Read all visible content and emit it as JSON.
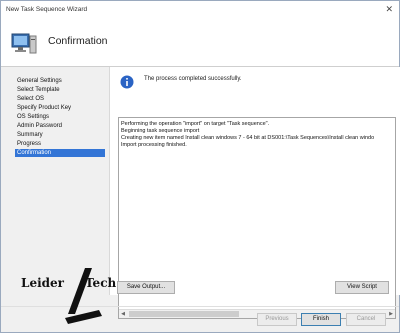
{
  "window": {
    "title": "New Task Sequence Wizard",
    "close_glyph": "✕"
  },
  "header": {
    "title": "Confirmation",
    "icon": "computer-icon"
  },
  "nav": {
    "items": [
      {
        "label": "General Settings"
      },
      {
        "label": "Select Template"
      },
      {
        "label": "Select OS"
      },
      {
        "label": "Specify Product Key"
      },
      {
        "label": "OS Settings"
      },
      {
        "label": "Admin Password"
      },
      {
        "label": "Summary"
      },
      {
        "label": "Progress"
      },
      {
        "label": "Confirmation"
      }
    ],
    "active_index": 8,
    "active_color": "#3375d6"
  },
  "content": {
    "status_message": "The process completed successfully.",
    "info_icon": "info-icon",
    "log_lines": [
      "Performing the operation \"import\" on target \"Task sequence\".",
      "Beginning task sequence import",
      "Creating new item named Install clean windows 7 - 64 bit at DS001:\\Task Sequences\\Install clean windo",
      "Import processing finished."
    ]
  },
  "buttons": {
    "save_output": "Save Output...",
    "view_script": "View Script",
    "previous": "Previous",
    "finish": "Finish",
    "cancel": "Cancel"
  },
  "watermark": {
    "left": "Leider",
    "right": "Tech"
  }
}
